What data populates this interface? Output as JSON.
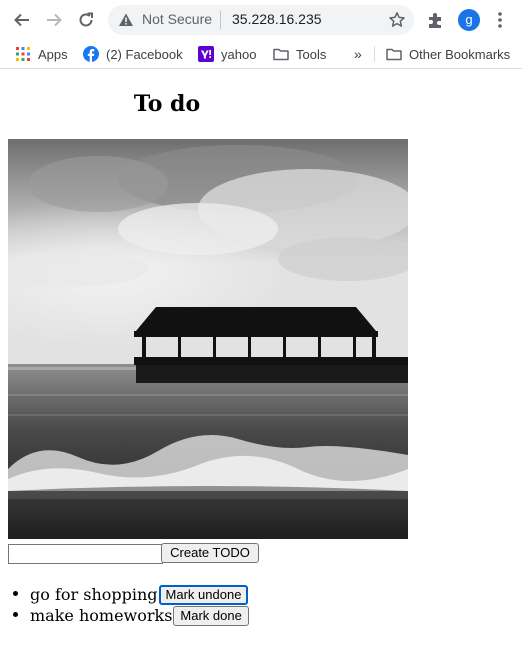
{
  "browser": {
    "security_label": "Not Secure",
    "url": "35.228.16.235",
    "profile_initial": "g",
    "bookmarks": [
      {
        "label": "Apps",
        "icon": "apps-grid-icon"
      },
      {
        "label": "(2) Facebook",
        "icon": "facebook-icon"
      },
      {
        "label": "yahoo",
        "icon": "yahoo-icon"
      },
      {
        "label": "Tools",
        "icon": "folder-icon"
      }
    ],
    "overflow_label": "»",
    "other_bookmarks_label": "Other Bookmarks"
  },
  "page": {
    "title": "To do",
    "input": {
      "value": "",
      "placeholder": ""
    },
    "create_button_label": "Create TODO",
    "todos": [
      {
        "text": "go for shopping",
        "button_label": "Mark undone",
        "done": true
      },
      {
        "text": "make homeworks",
        "button_label": "Mark done",
        "done": false
      }
    ]
  },
  "colors": {
    "profile_bg": "#1a73e8",
    "focus_ring": "#005fcc",
    "facebook": "#1877f2",
    "yahoo": "#6001d2"
  }
}
